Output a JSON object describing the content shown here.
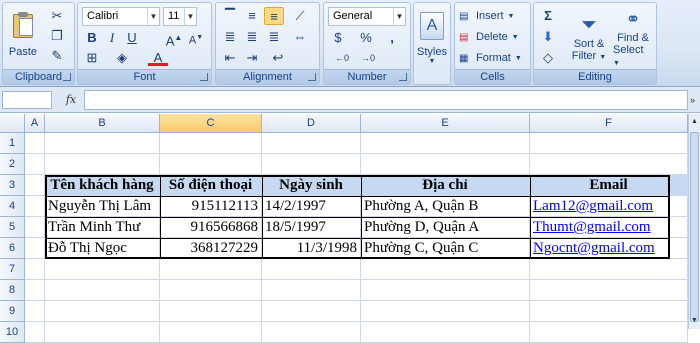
{
  "ribbon": {
    "clipboard": {
      "label": "Clipboard",
      "paste": "Paste"
    },
    "font": {
      "label": "Font",
      "name": "Calibri",
      "size": "11"
    },
    "alignment": {
      "label": "Alignment"
    },
    "number": {
      "label": "Number",
      "format": "General"
    },
    "styles": {
      "label": "Styles"
    },
    "cells": {
      "label": "Cells",
      "insert": "Insert",
      "delete": "Delete",
      "format": "Format"
    },
    "editing": {
      "label": "Editing",
      "sort": "Sort &",
      "filter": "Filter",
      "find": "Find &",
      "select": "Select"
    }
  },
  "formula_bar": {
    "fx": "fx",
    "value": ""
  },
  "columns": [
    "A",
    "B",
    "C",
    "D",
    "E",
    "F"
  ],
  "rows": [
    "1",
    "2",
    "3",
    "4",
    "5",
    "6",
    "7",
    "8",
    "9",
    "10"
  ],
  "selected_column": "C",
  "table": {
    "headers": [
      "Tên khách hàng",
      "Số điện thoại",
      "Ngày sinh",
      "Địa chỉ",
      "Email"
    ],
    "rows": [
      [
        "Nguyễn Thị Lâm",
        "915112113",
        "14/2/1997",
        "Phường A, Quận B",
        "Lam12@gmail.com"
      ],
      [
        "Trần Minh Thư",
        "916566868",
        "18/5/1997",
        "Phường D, Quận A",
        "Thumt@gmail.com"
      ],
      [
        "Đỗ Thị Ngọc",
        "368127229",
        "11/3/1998",
        " Phường C, Quận C",
        "Ngocnt@gmail.com"
      ]
    ]
  },
  "colors": {
    "header_fill": "#c6d9f1",
    "link": "#0000ff",
    "selected_col": "#f9c96a"
  }
}
